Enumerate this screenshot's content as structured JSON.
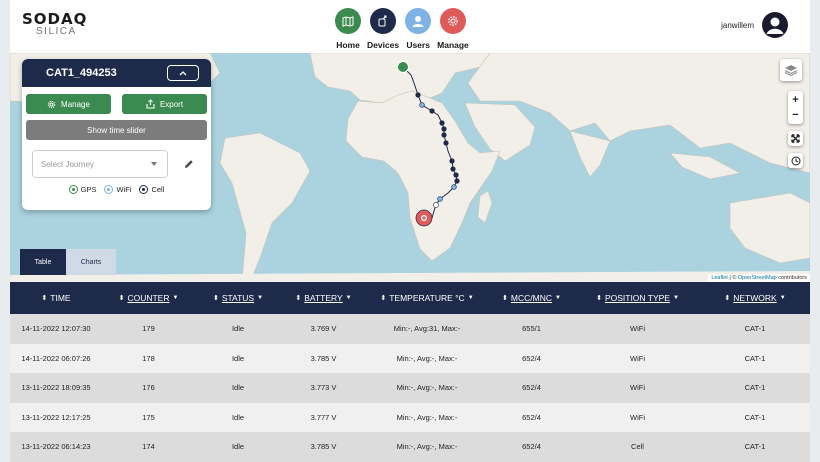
{
  "brand": {
    "name": "SODAQ",
    "product": "SILICA"
  },
  "nav": [
    {
      "label": "Home",
      "icon": "map-icon",
      "color": "#3b8a4f"
    },
    {
      "label": "Devices",
      "icon": "devices-icon",
      "color": "#1e2a4a"
    },
    {
      "label": "Users",
      "icon": "user-icon",
      "color": "#7fb2e5"
    },
    {
      "label": "Manage",
      "icon": "gear-icon",
      "color": "#e05a5a"
    }
  ],
  "user": {
    "name": "janwillem"
  },
  "panel": {
    "device_name": "CAT1_494253",
    "manage_label": "Manage",
    "export_label": "Export",
    "time_slider_label": "Show time slider",
    "journey_placeholder": "Select Journey",
    "legend": {
      "gps": "GPS",
      "wifi": "WiFi",
      "cell": "Cell"
    }
  },
  "map": {
    "attribution_leaflet": "Leaflet",
    "attribution_sep": " | © ",
    "attribution_osm": "OpenStreetMap",
    "attribution_tail": " contributors",
    "zoom_in": "+",
    "zoom_out": "−"
  },
  "tabs": {
    "table": "Table",
    "charts": "Charts"
  },
  "table": {
    "columns": [
      "TIME",
      "COUNTER",
      "STATUS",
      "BATTERY",
      "TEMPERATURE °C",
      "MCC/MNC",
      "POSITION TYPE",
      "NETWORK"
    ],
    "rows": [
      [
        "14-11-2022 12:07:30",
        "179",
        "Idle",
        "3.769 V",
        "Min:-, Avg:31, Max:-",
        "655/1",
        "WiFi",
        "CAT-1"
      ],
      [
        "14-11-2022 06:07:26",
        "178",
        "Idle",
        "3.785 V",
        "Min:-, Avg:-, Max:-",
        "652/4",
        "WiFi",
        "CAT-1"
      ],
      [
        "13-11-2022 18:09:35",
        "176",
        "Idle",
        "3.773 V",
        "Min:-, Avg:-, Max:-",
        "652/4",
        "WiFi",
        "CAT-1"
      ],
      [
        "13-11-2022 12:17:25",
        "175",
        "Idle",
        "3.777 V",
        "Min:-, Avg:-, Max:-",
        "652/4",
        "WiFi",
        "CAT-1"
      ],
      [
        "13-11-2022 06:14:23",
        "174",
        "Idle",
        "3.785 V",
        "Min:-, Avg:-, Max:-",
        "652/4",
        "Cell",
        "CAT-1"
      ]
    ]
  }
}
